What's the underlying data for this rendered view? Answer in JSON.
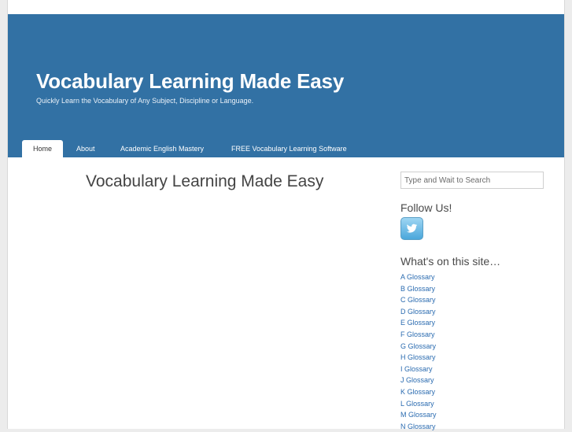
{
  "header": {
    "title": "Vocabulary Learning Made Easy",
    "tagline": "Quickly Learn the Vocabulary of Any Subject, Discipline or Language."
  },
  "nav": [
    {
      "label": "Home",
      "active": true
    },
    {
      "label": "About",
      "active": false
    },
    {
      "label": "Academic English Mastery",
      "active": false
    },
    {
      "label": "FREE Vocabulary Learning Software",
      "active": false
    }
  ],
  "main": {
    "title": "Vocabulary Learning Made Easy"
  },
  "sidebar": {
    "search": {
      "placeholder": "Type and Wait to Search",
      "value": ""
    },
    "follow_title": "Follow Us!",
    "follow_icon": "twitter-icon",
    "site_title": "What's on this site…",
    "links": [
      "A Glossary",
      "B Glossary",
      "C Glossary",
      "D Glossary",
      "E Glossary",
      "F Glossary",
      "G Glossary",
      "H Glossary",
      "I Glossary",
      "J Glossary",
      "K Glossary",
      "L Glossary",
      "M Glossary",
      "N Glossary"
    ]
  },
  "colors": {
    "header_bg": "#3271a4",
    "link": "#2a6bb0"
  }
}
